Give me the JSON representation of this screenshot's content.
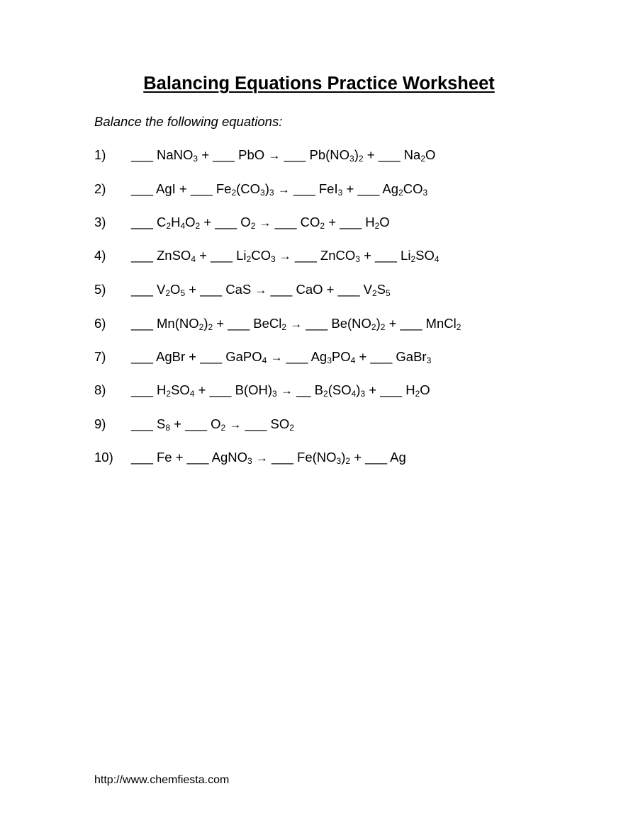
{
  "document": {
    "title": "Balancing Equations Practice Worksheet",
    "instructions": "Balance the following equations:",
    "equations": [
      {
        "number": "1)",
        "segments": [
          [
            "___ NaNO",
            ""
          ],
          [
            "3",
            "s"
          ],
          [
            " + ___ PbO ",
            ""
          ],
          [
            "→",
            "a"
          ],
          [
            " ___ Pb(NO",
            ""
          ],
          [
            "3",
            "s"
          ],
          [
            ")",
            ""
          ],
          [
            "2",
            "s"
          ],
          [
            " + ___ Na",
            ""
          ],
          [
            "2",
            "s"
          ],
          [
            "O",
            ""
          ]
        ]
      },
      {
        "number": "2)",
        "segments": [
          [
            "___ AgI + ___ Fe",
            ""
          ],
          [
            "2",
            "s"
          ],
          [
            "(CO",
            ""
          ],
          [
            "3",
            "s"
          ],
          [
            ")",
            ""
          ],
          [
            "3",
            "s"
          ],
          [
            " ",
            ""
          ],
          [
            "→",
            "a"
          ],
          [
            " ___ FeI",
            ""
          ],
          [
            "3",
            "s"
          ],
          [
            " + ___ Ag",
            ""
          ],
          [
            "2",
            "s"
          ],
          [
            "CO",
            ""
          ],
          [
            "3",
            "s"
          ]
        ]
      },
      {
        "number": "3)",
        "segments": [
          [
            "___ C",
            ""
          ],
          [
            "2",
            "s"
          ],
          [
            "H",
            ""
          ],
          [
            "4",
            "s"
          ],
          [
            "O",
            ""
          ],
          [
            "2",
            "s"
          ],
          [
            " + ___ O",
            ""
          ],
          [
            "2",
            "s"
          ],
          [
            " ",
            ""
          ],
          [
            "→",
            "a"
          ],
          [
            " ___ CO",
            ""
          ],
          [
            "2",
            "s"
          ],
          [
            " + ___ H",
            ""
          ],
          [
            "2",
            "s"
          ],
          [
            "O",
            ""
          ]
        ]
      },
      {
        "number": "4)",
        "segments": [
          [
            "___ ZnSO",
            ""
          ],
          [
            "4",
            "s"
          ],
          [
            " + ___ Li",
            ""
          ],
          [
            "2",
            "s"
          ],
          [
            "CO",
            ""
          ],
          [
            "3",
            "s"
          ],
          [
            " ",
            ""
          ],
          [
            "→",
            "a"
          ],
          [
            " ___ ZnCO",
            ""
          ],
          [
            "3",
            "s"
          ],
          [
            " + ___ Li",
            ""
          ],
          [
            "2",
            "s"
          ],
          [
            "SO",
            ""
          ],
          [
            "4",
            "s"
          ]
        ]
      },
      {
        "number": "5)",
        "segments": [
          [
            "___ V",
            ""
          ],
          [
            "2",
            "s"
          ],
          [
            "O",
            ""
          ],
          [
            "5",
            "s"
          ],
          [
            " + ___ CaS ",
            ""
          ],
          [
            "→",
            "a"
          ],
          [
            " ___ CaO + ___ V",
            ""
          ],
          [
            "2",
            "s"
          ],
          [
            "S",
            ""
          ],
          [
            "5",
            "s"
          ]
        ]
      },
      {
        "number": "6)",
        "segments": [
          [
            "___ Mn(NO",
            ""
          ],
          [
            "2",
            "s"
          ],
          [
            ")",
            ""
          ],
          [
            "2",
            "s"
          ],
          [
            " + ___ BeCl",
            ""
          ],
          [
            "2",
            "s"
          ],
          [
            " ",
            ""
          ],
          [
            "→",
            "a"
          ],
          [
            " ___ Be(NO",
            ""
          ],
          [
            "2",
            "s"
          ],
          [
            ")",
            ""
          ],
          [
            "2",
            "s"
          ],
          [
            " + ___ MnCl",
            ""
          ],
          [
            "2",
            "s"
          ]
        ]
      },
      {
        "number": "7)",
        "segments": [
          [
            "___ AgBr + ___ GaPO",
            ""
          ],
          [
            "4",
            "s"
          ],
          [
            " ",
            ""
          ],
          [
            "→",
            "a"
          ],
          [
            " ___ Ag",
            ""
          ],
          [
            "3",
            "s"
          ],
          [
            "PO",
            ""
          ],
          [
            "4",
            "s"
          ],
          [
            " + ___ GaBr",
            ""
          ],
          [
            "3",
            "s"
          ]
        ]
      },
      {
        "number": "8)",
        "segments": [
          [
            "___ H",
            ""
          ],
          [
            "2",
            "s"
          ],
          [
            "SO",
            ""
          ],
          [
            "4",
            "s"
          ],
          [
            " + ___ B(OH)",
            ""
          ],
          [
            "3",
            "s"
          ],
          [
            " ",
            ""
          ],
          [
            "→",
            "a"
          ],
          [
            " __ B",
            ""
          ],
          [
            "2",
            "s"
          ],
          [
            "(SO",
            ""
          ],
          [
            "4",
            "s"
          ],
          [
            ")",
            ""
          ],
          [
            "3",
            "s"
          ],
          [
            " + ___ H",
            ""
          ],
          [
            "2",
            "s"
          ],
          [
            "O",
            ""
          ]
        ]
      },
      {
        "number": "9)",
        "segments": [
          [
            "___ S",
            ""
          ],
          [
            "8",
            "s"
          ],
          [
            " + ___ O",
            ""
          ],
          [
            "2",
            "s"
          ],
          [
            " ",
            ""
          ],
          [
            "→",
            "a"
          ],
          [
            " ___ SO",
            ""
          ],
          [
            "2",
            "s"
          ]
        ]
      },
      {
        "number": "10)",
        "segments": [
          [
            "___ Fe + ___ AgNO",
            ""
          ],
          [
            "3",
            "s"
          ],
          [
            " ",
            ""
          ],
          [
            "→",
            "a"
          ],
          [
            " ___ Fe(NO",
            ""
          ],
          [
            "3",
            "s"
          ],
          [
            ")",
            ""
          ],
          [
            "2",
            "s"
          ],
          [
            " + ___ Ag",
            ""
          ]
        ]
      }
    ],
    "footer_url": "http://www.chemfiesta.com"
  }
}
